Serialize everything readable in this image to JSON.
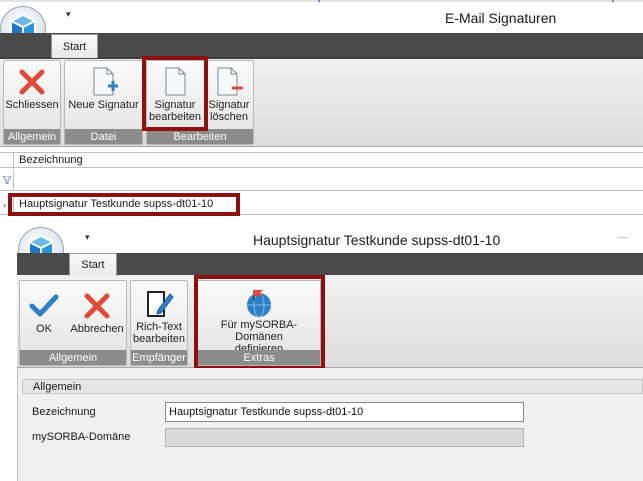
{
  "window1": {
    "title": "E-Mail Signaturen",
    "qa_glyph": "▾",
    "tab": "Start",
    "groups": [
      {
        "label": "Allgemein",
        "buttons": [
          {
            "label": "Schliessen",
            "icon": "close-x-icon"
          }
        ]
      },
      {
        "label": "Datei",
        "buttons": [
          {
            "label": "Neue Signatur",
            "icon": "new-document-icon"
          }
        ]
      },
      {
        "label": "Bearbeiten",
        "buttons": [
          {
            "label": "Signatur\nbearbeiten",
            "icon": "edit-document-icon"
          },
          {
            "label": "Signatur\nlöschen",
            "icon": "delete-document-icon"
          }
        ]
      }
    ],
    "grid": {
      "column": "Bezeichnung",
      "row_indicator": "›",
      "rows": [
        "Hauptsignatur Testkunde supss-dt01-10"
      ]
    }
  },
  "window2": {
    "title": "Hauptsignatur Testkunde supss-dt01-10",
    "qa_glyph": "▾",
    "tab": "Start",
    "groups": [
      {
        "label": "Allgemein",
        "buttons": [
          {
            "label": "OK",
            "icon": "checkmark-icon"
          },
          {
            "label": "Abbrechen",
            "icon": "cancel-x-icon"
          }
        ]
      },
      {
        "label": "Empfänger",
        "buttons": [
          {
            "label": "Rich-Text\nbearbeiten",
            "icon": "rich-text-edit-icon"
          }
        ]
      },
      {
        "label": "Extras",
        "buttons": [
          {
            "label": "Für mySORBA-Domänen\ndefinieren",
            "icon": "globe-flag-icon"
          }
        ]
      }
    ],
    "section": "Allgemein",
    "fields": {
      "bezeichnung_label": "Bezeichnung",
      "bezeichnung_value": "Hauptsignatur Testkunde supss-dt01-10",
      "domain_label": "mySORBA-Domäne",
      "domain_value": ""
    }
  },
  "colors": {
    "highlight": "#8d0f0f",
    "ribbon_bar": "#4a4a4a",
    "group_label_bg": "#8c8c8c",
    "accent_blue": "#2e7fc8",
    "close_red": "#e04a3a"
  }
}
